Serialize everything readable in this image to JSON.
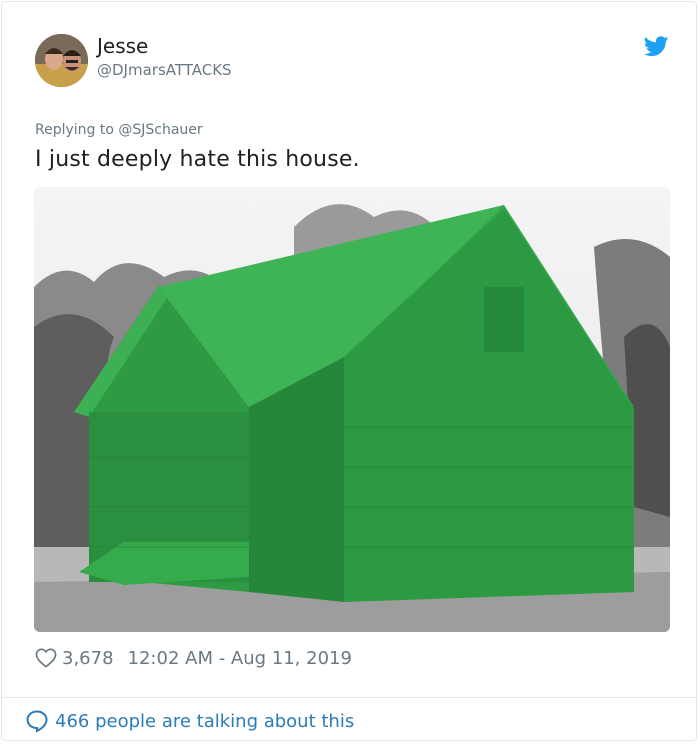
{
  "tweet": {
    "author_name": "Jesse",
    "author_handle": "@DJmarsATTACKS",
    "reply_to": "Replying to @SJSchauer",
    "text": "I just deeply hate this house.",
    "likes": "3,678",
    "timestamp": "12:02 AM - Aug 11, 2019",
    "conversation": "466 people are talking about this"
  },
  "icons": {
    "brand": "twitter-bird-icon",
    "like": "heart-icon",
    "reply": "speech-bubble-icon"
  },
  "colors": {
    "brand_blue": "#1da1f2",
    "link_blue": "#2b7bb9",
    "muted_text": "#697882",
    "house_green": "#2e9e44"
  }
}
